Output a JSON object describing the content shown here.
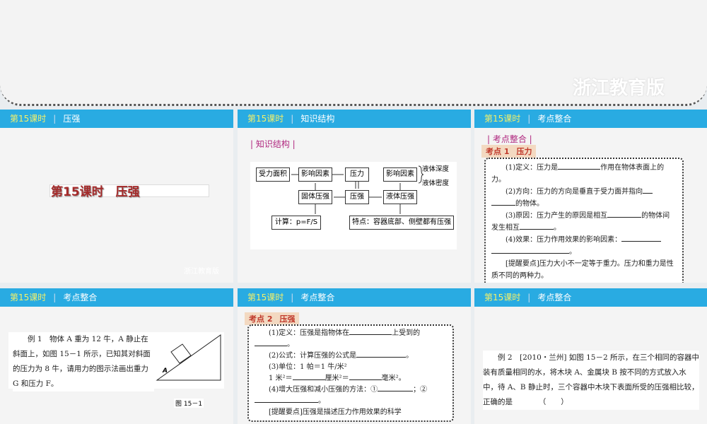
{
  "top": {
    "brand": "浙江教育版"
  },
  "slides": [
    {
      "num": "第15课时",
      "sep": "|",
      "title": "压强",
      "main_title": "第15课时　压强",
      "brand": "浙江教育版"
    },
    {
      "num": "第15课时",
      "sep": "|",
      "title": "知识结构",
      "tag": "| 知识结构 |",
      "diagram": {
        "b1": "受力面积",
        "b2": "影响因素",
        "b3": "压力",
        "b4": "影响因素",
        "b5": "液体深度",
        "b6": "液体密度",
        "b7": "固体压强",
        "b8": "压强",
        "b9": "液体压强",
        "b10": "计算：p=F/S",
        "b11": "特点：容器底部、侧壁都有压强"
      }
    },
    {
      "num": "第15课时",
      "sep": "|",
      "title": "考点整合",
      "tag": "| 考点整合 |",
      "kp_label": "考点 1",
      "kp_title": "压力",
      "lines": [
        "(1)定义：压力是",
        "作用在物体表面上的力。",
        "(2)方向：压力的方向是垂直于受力面并指向",
        "的物体。",
        "(3)原因：压力产生的原因是相互",
        "的物体间发生相互",
        "。",
        "(4)效果：压力作用效果的影响因素：",
        "。",
        "[提醒要点]压力大小不一定等于重力。压力和重力是性质不同的两种力。"
      ]
    },
    {
      "num": "第15课时",
      "sep": "|",
      "title": "考点整合",
      "example": "例 1　物体 A 重为 12 牛，A 静止在斜面上，如图 15－1 所示，已知其对斜面的压力为 8 牛，请用力的图示法画出重力 G 和压力 F。",
      "fig_label": "A",
      "caption": "图 15－1"
    },
    {
      "num": "第15课时",
      "sep": "|",
      "title": "考点整合",
      "kp_label": "考点 2",
      "kp_title": "压强",
      "lines": [
        "(1)定义：压强是指物体在",
        "上受到的",
        "。",
        "(2)公式：计算压强的公式是",
        "。",
        "(3)单位：1 帕＝1 牛/米²",
        "1 米²＝",
        "厘米²＝",
        "毫米²。",
        "(4)增大压强和减小压强的方法：①",
        "；②",
        "。",
        "[提醒要点]压强是描述压力作用效果的科学"
      ]
    },
    {
      "num": "第15课时",
      "sep": "|",
      "title": "考点整合",
      "example": "例 2　[2010・兰州] 如图 15－2 所示，在三个相同的容器中装有质量相同的水，将木块 A、金属块 B 按不同的方式放入水中，待 A、B 静止时，三个容器中木块下表面所受的压强相比较，正确的是　　　　（　　）"
    }
  ]
}
